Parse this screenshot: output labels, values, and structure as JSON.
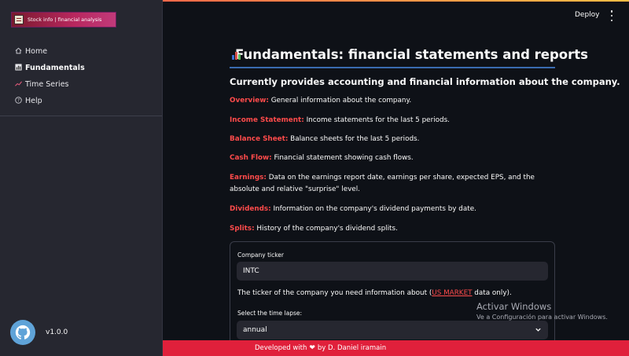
{
  "app": {
    "brand": "Stock info | financial analysis",
    "version": "v1.0.0",
    "accent_color": "#ff4b4b"
  },
  "toolbar": {
    "deploy_label": "Deploy",
    "menu_icon": "kebab-menu-icon"
  },
  "sidebar": {
    "items": [
      {
        "label": "Home",
        "icon": "home-icon",
        "active": false
      },
      {
        "label": "Fundamentals",
        "icon": "bar-chart-icon",
        "active": true
      },
      {
        "label": "Time Series",
        "icon": "trend-line-icon",
        "active": false
      },
      {
        "label": "Help",
        "icon": "help-icon",
        "active": false
      }
    ]
  },
  "main": {
    "title": "Fundamentals: financial statements and reports",
    "subtitle": "Currently provides accounting and financial information about the company.",
    "descriptions": [
      {
        "term": "Overview:",
        "text": "General information about the company."
      },
      {
        "term": "Income Statement:",
        "text": "Income statements for the last 5 periods."
      },
      {
        "term": "Balance Sheet:",
        "text": "Balance sheets for the last 5 periods."
      },
      {
        "term": "Cash Flow:",
        "text": "Financial statement showing cash flows."
      },
      {
        "term": "Earnings:",
        "text": "Data on the earnings report date, earnings per share, expected EPS, and the absolute and relative \"surprise\" level."
      },
      {
        "term": "Dividends:",
        "text": "Information on the company's dividend payments by date."
      },
      {
        "term": "Splits:",
        "text": "History of the company's dividend splits."
      }
    ],
    "form": {
      "ticker_label": "Company ticker",
      "ticker_value": "INTC",
      "help_prefix": "The ticker of the company you need information about (",
      "help_link": "US MARKET",
      "help_suffix": " data only).",
      "timelapse_label": "Select the time lapse:",
      "timelapse_value": "annual"
    }
  },
  "watermark": {
    "title": "Activar Windows",
    "subtitle": "Ve a Configuración para activar Windows."
  },
  "footer": {
    "prefix": "Developed with",
    "suffix": "by D. Daniel iramain"
  }
}
